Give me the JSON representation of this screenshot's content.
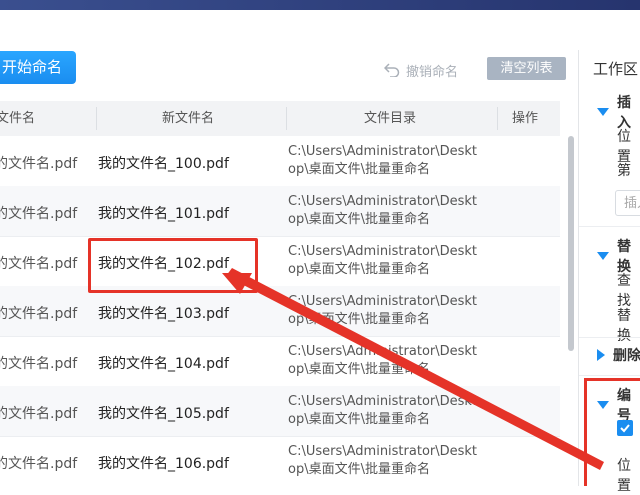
{
  "toolbar": {
    "start_label": "开始命名",
    "undo_label": "撤销命名",
    "clear_label": "清空列表"
  },
  "table": {
    "headers": [
      "文件名",
      "新文件名",
      "文件目录",
      "操作"
    ],
    "rows": [
      {
        "old": "的文件名.pdf",
        "new": "我的文件名_100.pdf",
        "dir1": "C:\\Users\\Administrator\\Deskt",
        "dir2": "op\\桌面文件\\批量重命名"
      },
      {
        "old": "的文件名.pdf",
        "new": "我的文件名_101.pdf",
        "dir1": "C:\\Users\\Administrator\\Deskt",
        "dir2": "op\\桌面文件\\批量重命名"
      },
      {
        "old": "的文件名.pdf",
        "new": "我的文件名_102.pdf",
        "dir1": "C:\\Users\\Administrator\\Deskt",
        "dir2": "op\\桌面文件\\批量重命名"
      },
      {
        "old": "的文件名.pdf",
        "new": "我的文件名_103.pdf",
        "dir1": "C:\\Users\\Administrator\\Deskt",
        "dir2": "op\\桌面文件\\批量重命名"
      },
      {
        "old": "的文件名.pdf",
        "new": "我的文件名_104.pdf",
        "dir1": "C:\\Users\\Administrator\\Deskt",
        "dir2": "op\\桌面文件\\批量重命名"
      },
      {
        "old": "的文件名.pdf",
        "new": "我的文件名_105.pdf",
        "dir1": "C:\\Users\\Administrator\\Deskt",
        "dir2": "op\\桌面文件\\批量重命名"
      },
      {
        "old": "的文件名.pdf",
        "new": "我的文件名_106.pdf",
        "dir1": "C:\\Users\\Administrator\\Deskt",
        "dir2": "op\\桌面文件\\批量重命名"
      }
    ]
  },
  "panel": {
    "title": "工作区",
    "insert_title": "插入",
    "position_label": "位置",
    "nth_label": "第",
    "insert_placeholder": "插入",
    "replace_title": "替换",
    "find_label": "查找",
    "replace_label": "替换",
    "delete_title": "删除",
    "number_title": "编号",
    "number_position_label": "位置"
  },
  "colors": {
    "accent": "#1a8df0",
    "annotation": "#e53328"
  }
}
